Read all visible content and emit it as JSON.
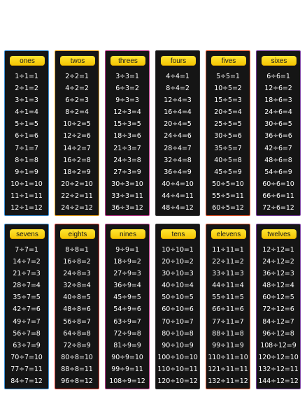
{
  "cards": [
    {
      "title": "ones",
      "border": "#3a8fd6",
      "facts": [
        "1÷1=1",
        "2÷1=2",
        "3÷1=3",
        "4÷1=4",
        "5÷1=5",
        "6÷1=6",
        "7÷1=7",
        "8÷1=8",
        "9÷1=9",
        "10÷1=10",
        "11÷1=11",
        "12÷1=12"
      ]
    },
    {
      "title": "twos",
      "border": "#f2a51c",
      "facts": [
        "2÷2=1",
        "4÷2=2",
        "6÷2=3",
        "8÷2=4",
        "10÷2=5",
        "12÷2=6",
        "14÷2=7",
        "16÷2=8",
        "18÷2=9",
        "20÷2=10",
        "22÷2=11",
        "24÷2=12"
      ]
    },
    {
      "title": "threes",
      "border": "#c13a8e",
      "facts": [
        "3÷3=1",
        "6÷3=2",
        "9÷3=3",
        "12÷3=4",
        "15÷3=5",
        "18÷3=6",
        "21÷3=7",
        "24÷3=8",
        "27÷3=9",
        "30÷3=10",
        "33÷3=11",
        "36÷3=12"
      ]
    },
    {
      "title": "fours",
      "border": "#333333",
      "facts": [
        "4÷4=1",
        "8÷4=2",
        "12÷4=3",
        "16÷4=4",
        "20÷4=5",
        "24÷4=6",
        "28÷4=7",
        "32÷4=8",
        "36÷4=9",
        "40÷4=10",
        "44÷4=11",
        "48÷4=12"
      ]
    },
    {
      "title": "fives",
      "border": "#e8542a",
      "facts": [
        "5÷5=1",
        "10÷5=2",
        "15÷5=3",
        "20÷5=4",
        "25÷5=5",
        "30÷5=6",
        "35÷5=7",
        "40÷5=8",
        "45÷5=9",
        "50÷5=10",
        "55÷5=11",
        "60÷5=12"
      ]
    },
    {
      "title": "sixes",
      "border": "#7a3fa0",
      "facts": [
        "6÷6=1",
        "12÷6=2",
        "18÷6=3",
        "24÷6=4",
        "30÷6=5",
        "36÷6=6",
        "42÷6=7",
        "48÷6=8",
        "54÷6=9",
        "60÷6=10",
        "66÷6=11",
        "72÷6=12"
      ]
    },
    {
      "title": "sevens",
      "border": "#3a8fd6",
      "facts": [
        "7÷7=1",
        "14÷7=2",
        "21÷7=3",
        "28÷7=4",
        "35÷7=5",
        "42÷7=6",
        "49÷7=7",
        "56÷7=8",
        "63÷7=9",
        "70÷7=10",
        "77÷7=11",
        "84÷7=12"
      ]
    },
    {
      "title": "eights",
      "border": "#e8342a",
      "facts": [
        "8÷8=1",
        "16÷8=2",
        "24÷8=3",
        "32÷8=4",
        "40÷8=5",
        "48÷8=6",
        "56÷8=7",
        "64÷8=8",
        "72÷8=9",
        "80÷8=10",
        "88÷8=11",
        "96÷8=12"
      ]
    },
    {
      "title": "nines",
      "border": "#c13a8e",
      "facts": [
        "9÷9=1",
        "18÷9=2",
        "27÷9=3",
        "36÷9=4",
        "45÷9=5",
        "54÷9=6",
        "63÷9=7",
        "72÷9=8",
        "81÷9=9",
        "90÷9=10",
        "99÷9=11",
        "108÷9=12"
      ]
    },
    {
      "title": "tens",
      "border": "#333333",
      "facts": [
        "10÷10=1",
        "20÷10=2",
        "30÷10=3",
        "40÷10=4",
        "50÷10=5",
        "60÷10=6",
        "70÷10=7",
        "80÷10=8",
        "90÷10=9",
        "100÷10=10",
        "110÷10=11",
        "120÷10=12"
      ]
    },
    {
      "title": "elevens",
      "border": "#e8542a",
      "facts": [
        "11÷11=1",
        "22÷11=2",
        "33÷11=3",
        "44÷11=4",
        "55÷11=5",
        "66÷11=6",
        "77÷11=7",
        "88÷11=8",
        "99÷11=9",
        "110÷11=10",
        "121÷11=11",
        "132÷11=12"
      ]
    },
    {
      "title": "twelves",
      "border": "#7a3fa0",
      "facts": [
        "12÷12=1",
        "24÷12=2",
        "36÷12=3",
        "48÷12=4",
        "60÷12=5",
        "72÷12=6",
        "84÷12=7",
        "96÷12=8",
        "108÷12=9",
        "120÷12=10",
        "132÷12=11",
        "144÷12=12"
      ]
    }
  ]
}
